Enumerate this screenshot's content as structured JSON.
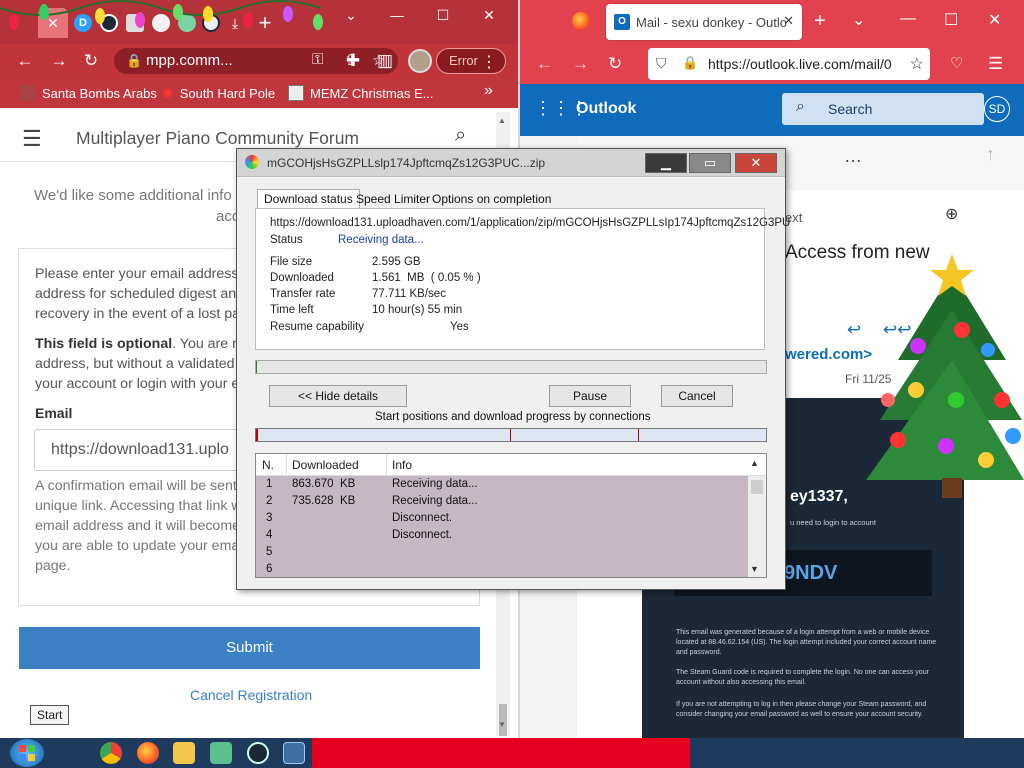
{
  "chrome": {
    "tabs": [
      {
        "icon": "close-icon",
        "label": "✕"
      },
      {
        "icon": "disqus-icon",
        "label": "D"
      },
      {
        "icon": "steam-icon"
      },
      {
        "icon": "shield-icon"
      },
      {
        "icon": "game-icon"
      },
      {
        "icon": "game-icon"
      },
      {
        "icon": "steam-icon"
      },
      {
        "icon": "download-icon"
      }
    ],
    "new_tab_label": "+",
    "address": "mpp.comm...",
    "error_badge": "Error",
    "bookmarks": [
      {
        "label": "Santa Bombs Arabs",
        "icon": "santa-icon"
      },
      {
        "label": "South Hard Pole",
        "icon": "snowflake-icon"
      },
      {
        "label": "MEMZ Christmas E...",
        "icon": "memz-icon"
      }
    ],
    "bookmarks_more": "»",
    "colors": {
      "frame": "#b5323a",
      "accent": "#3b7fc4"
    }
  },
  "forum": {
    "title": "Multiplayer Piano Community Forum",
    "intro_line1": "We'd like some additional info",
    "intro_line2": "acc",
    "para1_l1": "Please enter your email address",
    "para1_l2": "address for scheduled digest and",
    "para1_l3": "recovery in the event of a lost pa",
    "para2_bold": "This field is optional",
    "para2_l1_rest": ". You are no",
    "para2_l2": "address, but without a validated",
    "para2_l3": "your account or login with your e",
    "email_label": "Email",
    "email_value": "https://download131.uplo",
    "para3_l1": "A confirmation email will be sent",
    "para3_l2": "unique link. Accessing that link w",
    "para3_l3": "email address and it will become",
    "para3_l4": "you are able to update your ema",
    "para3_l5": "page.",
    "submit_label": "Submit",
    "cancel_label": "Cancel Registration",
    "start_tooltip": "Start"
  },
  "firefox": {
    "tab_title": "Mail - sexu donkey - Outlo",
    "url": "https://outlook.live.com/mail/0",
    "app_name": "Outlook",
    "search_placeholder": "Search",
    "avatar_initials": "SD",
    "email_context": "ext",
    "email_subject": "Access from new",
    "email_sender_fragment": "wered.com>",
    "email_date": "Fri 11/25",
    "email_greeting": "ey1337,",
    "email_need_login": "u need to login to account",
    "steam_code": "9NDV",
    "steam_p1": "This email was generated because of a login attempt from a web or mobile device located at 88.46.62.154 (US). The login attempt included your correct account name and password.",
    "steam_p2": "The Steam Guard code is required to complete the login. No one can access your account without also accessing this email.",
    "steam_p3": "If you are not attempting to log in then please change your Steam password, and consider changing your email password as well to ensure your account security."
  },
  "dialog": {
    "title": "mGCOHjsHsGZPLLslp174JpftcmqZs12G3PUC...zip",
    "tabs": [
      "Download status",
      "Speed Limiter",
      "Options on completion"
    ],
    "url": "https://download131.uploadhaven.com/1/application/zip/mGCOHjsHsGZPLLsIp174JpftcmqZs12G3PU",
    "status_label": "Status",
    "status_value": "Receiving data...",
    "fields": [
      {
        "label": "File size",
        "value": "2.595  GB"
      },
      {
        "label": "Downloaded",
        "value": "1.561  MB  ( 0.05 % )"
      },
      {
        "label": "Transfer rate",
        "value": "77.711  KB/sec"
      },
      {
        "label": "Time left",
        "value": "10 hour(s) 55 min"
      }
    ],
    "resume_label": "Resume capability",
    "resume_value": "Yes",
    "progress_fraction": 0.0005,
    "hide_details_label": "<< Hide details",
    "pause_label": "Pause",
    "cancel_label": "Cancel",
    "connections_label": "Start positions and download progress by connections",
    "list_headers": [
      "N.",
      "Downloaded",
      "Info"
    ],
    "connections": [
      {
        "n": "1",
        "downloaded": "863.670  KB",
        "info": "Receiving data..."
      },
      {
        "n": "2",
        "downloaded": "735.628  KB",
        "info": "Receiving data..."
      },
      {
        "n": "3",
        "downloaded": "",
        "info": "Disconnect."
      },
      {
        "n": "4",
        "downloaded": "",
        "info": "Disconnect."
      },
      {
        "n": "5",
        "downloaded": "",
        "info": ""
      },
      {
        "n": "6",
        "downloaded": "",
        "info": ""
      }
    ]
  },
  "taskbar": {
    "icons": [
      "start-icon",
      "chrome-icon",
      "firefox-icon",
      "explorer-icon",
      "notepad-icon",
      "steam-icon",
      "idm-icon"
    ]
  }
}
